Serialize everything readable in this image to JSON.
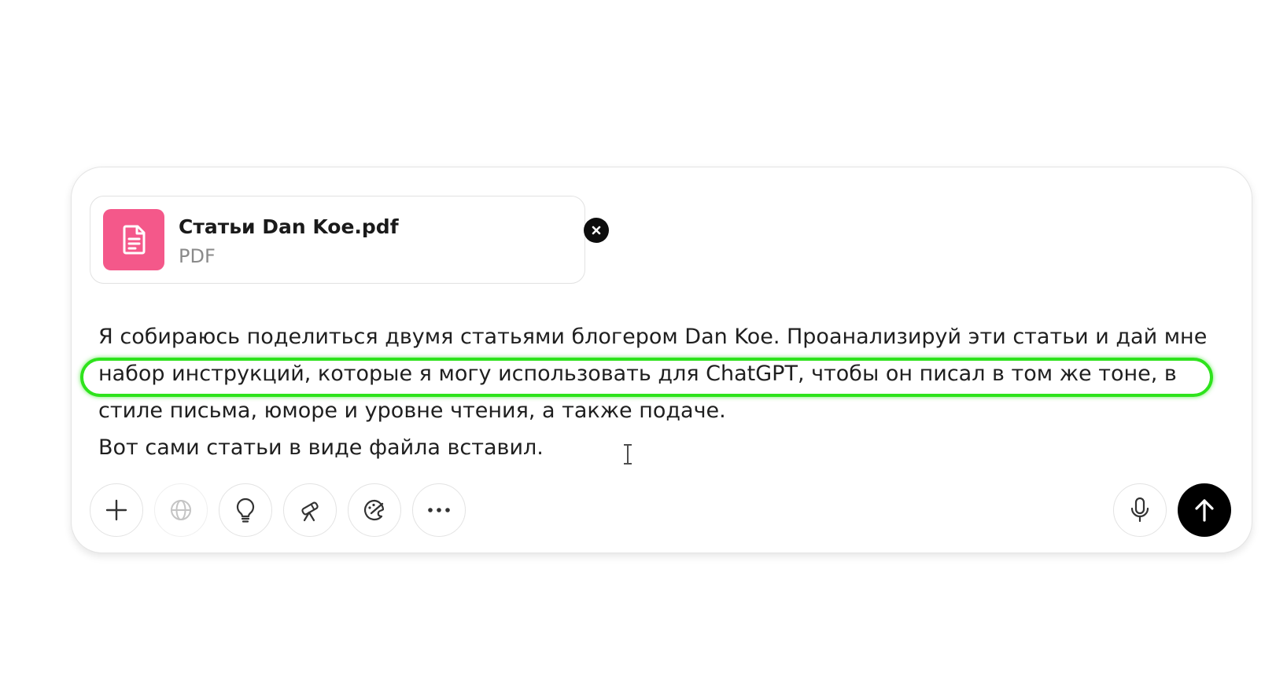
{
  "attachment": {
    "file_name": "Статьи Dan Koe.pdf",
    "file_type": "PDF",
    "icon": "document-icon",
    "icon_color": "#f4588a",
    "remove_icon": "close-icon"
  },
  "prompt": {
    "text": "Я собираюсь поделиться двумя статьями блогером Dan Koe. Проанализируй эти статьи и дай мне набор инструкций, которые я могу использовать для ChatGPT, чтобы он писал в том же тоне, в стиле письма, юморе и уровне чтения, а также подаче.",
    "text_line2": "Вот сами статьи в виде файла вставил."
  },
  "annotation": {
    "highlight_color": "#2ee31c"
  },
  "toolbar": {
    "left_buttons": [
      "plus-icon",
      "globe-icon",
      "lightbulb-icon",
      "telescope-icon",
      "brush-icon",
      "more-icon"
    ],
    "right_buttons": [
      "microphone-icon",
      "send-arrow-icon"
    ],
    "send_color": "#000000"
  }
}
